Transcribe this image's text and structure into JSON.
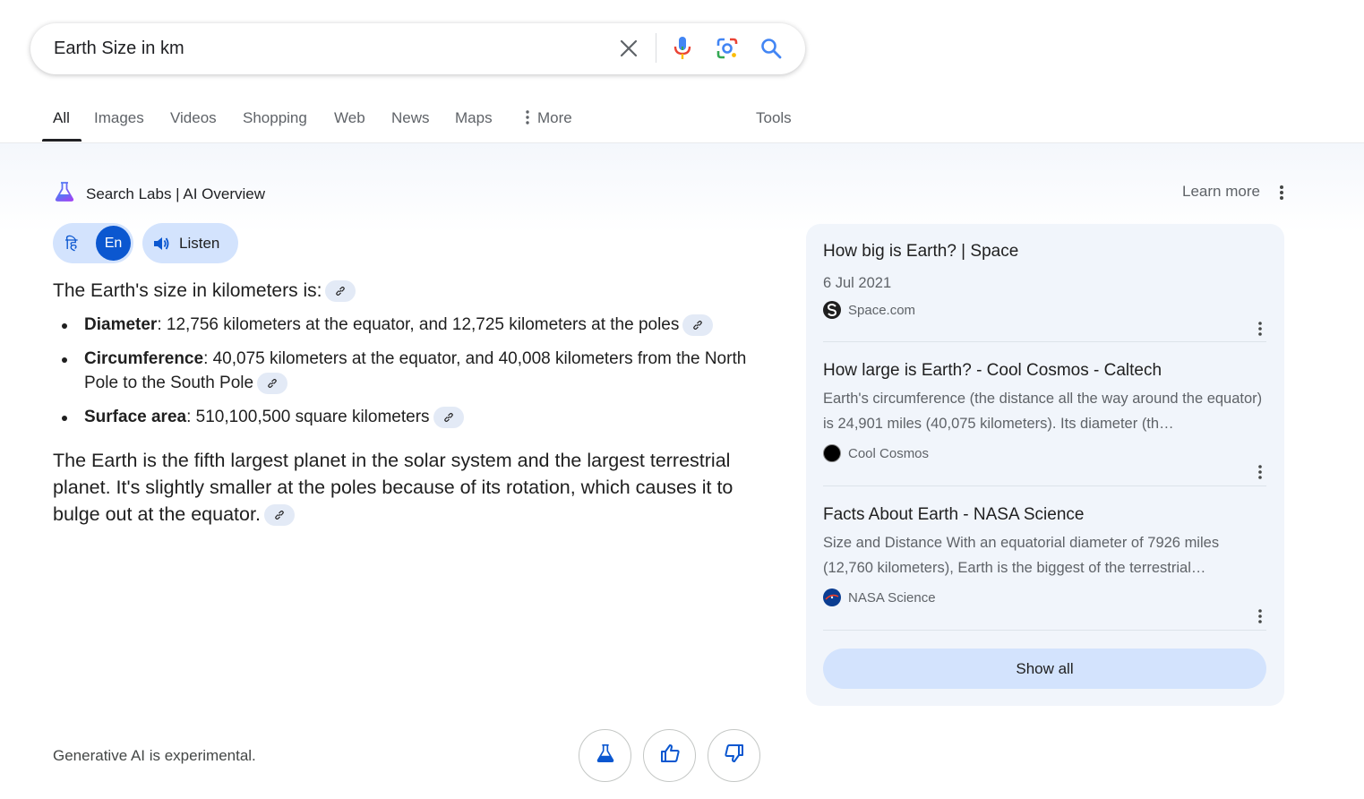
{
  "search": {
    "query": "Earth Size in km"
  },
  "icons": {
    "clear": "close-icon",
    "voice": "microphone-icon",
    "lens": "lens-icon",
    "search": "search-icon",
    "more": "kebab-icon",
    "labs": "flask-icon",
    "listen": "speaker-icon",
    "link": "link-icon",
    "thumbs_up": "thumbs-up-icon",
    "thumbs_down": "thumbs-down-icon"
  },
  "tabs": {
    "all": "All",
    "images": "Images",
    "videos": "Videos",
    "shopping": "Shopping",
    "web": "Web",
    "news": "News",
    "maps": "Maps",
    "more": "More",
    "tools": "Tools"
  },
  "overview": {
    "header": "Search Labs | AI Overview",
    "learn_more": "Learn more",
    "lang_hindi": "हि",
    "lang_english": "En",
    "listen": "Listen",
    "intro": "The Earth's size in kilometers is:",
    "bullets": [
      {
        "term": "Diameter",
        "text": ": 12,756 kilometers at the equator, and 12,725 kilometers at the poles"
      },
      {
        "term": "Circumference",
        "text": ": 40,075 kilometers at the equator, and 40,008 kilometers from the North Pole to the South Pole"
      },
      {
        "term": "Surface area",
        "text": ": 510,100,500 square kilometers"
      }
    ],
    "paragraph": "The Earth is the fifth largest planet in the solar system and the largest terrestrial planet. It's slightly smaller at the poles because of its rotation, which causes it to bulge out at the equator.",
    "disclaimer": "Generative AI is experimental."
  },
  "sources": [
    {
      "title": "How big is Earth? | Space",
      "meta": "6 Jul 2021",
      "site": "Space.com"
    },
    {
      "title": "How large is Earth? - Cool Cosmos - Caltech",
      "meta": "Earth's circumference (the distance all the way around the equator) is 24,901 miles (40,075 kilometers). Its diameter (th…",
      "site": "Cool Cosmos"
    },
    {
      "title": "Facts About Earth - NASA Science",
      "meta": "Size and Distance With an equatorial diameter of 7926 miles (12,760 kilometers), Earth is the biggest of the terrestrial…",
      "site": "NASA Science"
    }
  ],
  "show_all": "Show all",
  "colors": {
    "accent": "#0b57d0",
    "pill": "#d3e3fd",
    "panel": "#f1f5fb"
  }
}
